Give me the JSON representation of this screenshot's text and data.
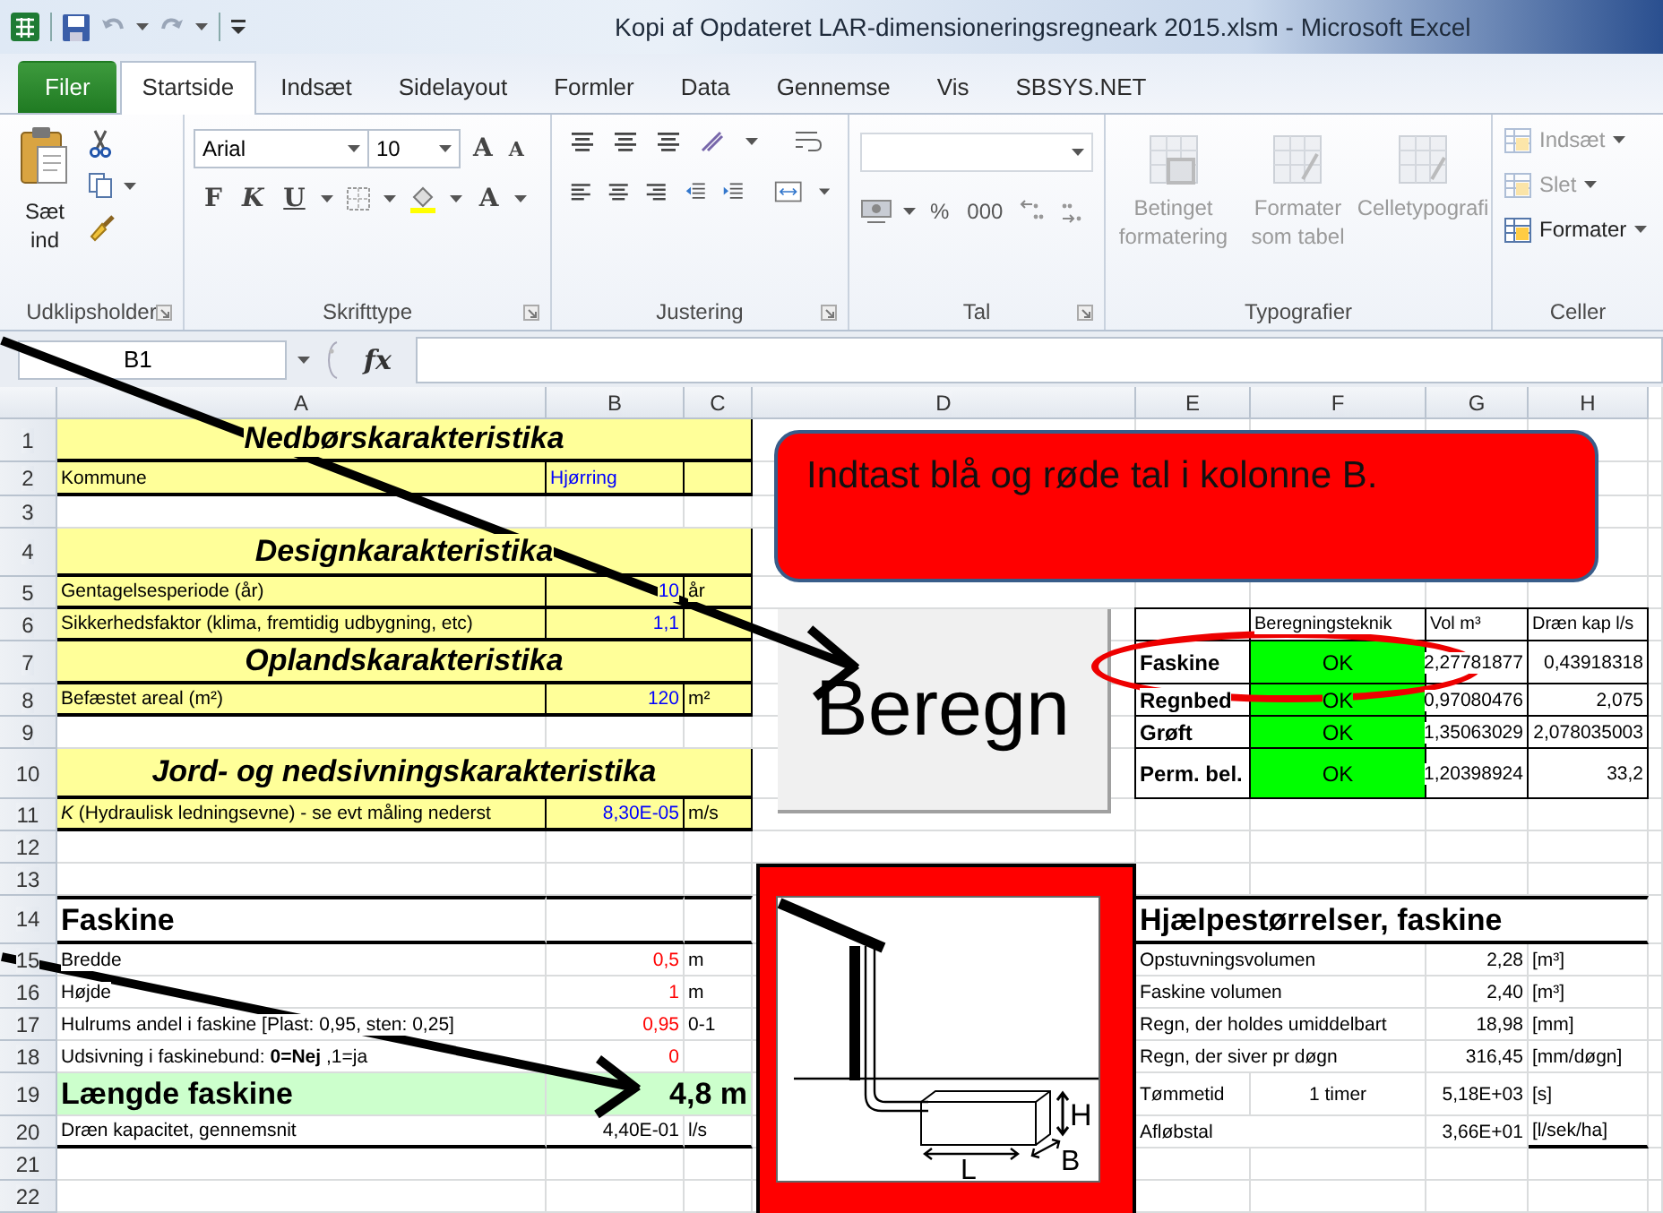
{
  "window": {
    "title": "Kopi af Opdateret LAR-dimensioneringsregneark 2015.xlsm  -  Microsoft Excel"
  },
  "tabs": [
    {
      "label": "Filer",
      "kind": "file",
      "selected": false
    },
    {
      "label": "Startside",
      "kind": "tab",
      "selected": true
    },
    {
      "label": "Indsæt",
      "kind": "tab",
      "selected": false
    },
    {
      "label": "Sidelayout",
      "kind": "tab",
      "selected": false
    },
    {
      "label": "Formler",
      "kind": "tab",
      "selected": false
    },
    {
      "label": "Data",
      "kind": "tab",
      "selected": false
    },
    {
      "label": "Gennemse",
      "kind": "tab",
      "selected": false
    },
    {
      "label": "Vis",
      "kind": "tab",
      "selected": false
    },
    {
      "label": "SBSYS.NET",
      "kind": "tab",
      "selected": false
    }
  ],
  "ribbon": {
    "clipboard": {
      "group": "Udklipsholder",
      "paste": "Sæt ind"
    },
    "font": {
      "group": "Skrifttype",
      "family": "Arial",
      "size": "10",
      "grow": "A",
      "shrink": "A",
      "bold": "F",
      "italic": "K",
      "underline": "U",
      "color_button": "A"
    },
    "alignment": {
      "group": "Justering"
    },
    "number": {
      "group": "Tal",
      "percent": "%",
      "thousands": "000"
    },
    "styles": {
      "group": "Typografier",
      "items": [
        {
          "label": "Betinget formatering",
          "disabled": true
        },
        {
          "label": "Formater som tabel",
          "disabled": true
        },
        {
          "label": "Celletypografi",
          "disabled": true
        }
      ]
    },
    "cells": {
      "group": "Celler",
      "items": [
        {
          "label": "Indsæt",
          "disabled": true
        },
        {
          "label": "Slet",
          "disabled": true
        },
        {
          "label": "Formater",
          "disabled": false
        }
      ]
    }
  },
  "formula_bar": {
    "name_box": "B1",
    "function_label": "fx"
  },
  "sheet": {
    "columns": [
      "A",
      "B",
      "C",
      "D",
      "E",
      "F",
      "G",
      "H"
    ],
    "rows": [
      {
        "number": "1",
        "kind": "section",
        "label": "Nedbørskarakteristika"
      },
      {
        "number": "2",
        "kind": "field_text",
        "label": "Kommune",
        "value": "Hjørring"
      },
      {
        "number": "3",
        "kind": "blank"
      },
      {
        "number": "4",
        "kind": "section",
        "label": "Designkarakteristika"
      },
      {
        "number": "5",
        "kind": "field",
        "label": "Gentagelsesperiode (år)",
        "value": "10",
        "unit": "år"
      },
      {
        "number": "6",
        "kind": "field",
        "label": "Sikkerhedsfaktor (klima, fremtidig udbygning, etc)",
        "value": "1,1"
      },
      {
        "number": "7",
        "kind": "section",
        "label": "Oplandskarakteristika"
      },
      {
        "number": "8",
        "kind": "field",
        "label": "Befæstet areal (m²)",
        "value": "120",
        "unit": "m²"
      },
      {
        "number": "9",
        "kind": "blank"
      },
      {
        "number": "10",
        "kind": "section",
        "label": "Jord- og nedsivningskarakteristika"
      },
      {
        "number": "11",
        "kind": "field",
        "label": "*K* (Hydraulisk ledningsevne) - se evt måling nederst",
        "value": "8,30E-05",
        "unit": "m/s"
      },
      {
        "number": "12",
        "kind": "blank"
      },
      {
        "number": "13",
        "kind": "blank"
      },
      {
        "number": "14",
        "kind": "heading",
        "label": "Faskine"
      },
      {
        "number": "15",
        "kind": "input",
        "label": "Bredde",
        "value": "0,5",
        "unit": "m"
      },
      {
        "number": "16",
        "kind": "input",
        "label": "Højde",
        "value": "1",
        "unit": "m"
      },
      {
        "number": "17",
        "kind": "input",
        "label": "Hulrums andel i faskine [Plast: 0,95, sten: 0,25]",
        "value": "0,95",
        "unit": "0-1"
      },
      {
        "number": "18",
        "kind": "input",
        "label": "Udsivning i faskinebund: **0=Nej** ,1=ja",
        "value": "0"
      },
      {
        "number": "19",
        "kind": "result",
        "label": "Længde faskine",
        "value": "4,8 m"
      },
      {
        "number": "20",
        "kind": "plain",
        "label": "Dræn kapacitet, gennemsnit",
        "value": "4,40E-01",
        "unit": "l/s"
      },
      {
        "number": "21",
        "kind": "blank"
      },
      {
        "number": "22",
        "kind": "blank"
      }
    ],
    "notice": "Indtast blå og røde tal i kolonne B.",
    "calc_button": "Beregn",
    "results": {
      "header": [
        "Beregningsteknik",
        "Vol m³",
        "Dræn kap l/s"
      ],
      "rows": [
        {
          "name": "Faskine",
          "status": "OK",
          "volume": "2,27781877",
          "capacity": "0,43918318"
        },
        {
          "name": "Regnbed",
          "status": "OK",
          "volume": "0,97080476",
          "capacity": "2,075"
        },
        {
          "name": "Grøft",
          "status": "OK",
          "volume": "1,35063029",
          "capacity": "2,078035003"
        },
        {
          "name": "Perm. bel.",
          "status": "OK",
          "volume": "1,20398924",
          "capacity": "33,2"
        }
      ]
    },
    "helper": {
      "title": "Hjælpestørrelser, faskine",
      "rows": [
        {
          "label": "Opstuvningsvolumen",
          "value": "2,28",
          "unit": "[m³]"
        },
        {
          "label": "Faskine volumen",
          "value": "2,40",
          "unit": "[m³]"
        },
        {
          "label": "Regn, der holdes umiddelbart",
          "value": "18,98",
          "unit": "[mm]"
        },
        {
          "label": "Regn, der siver pr døgn",
          "value": "316,45",
          "unit": "[mm/døgn]"
        },
        {
          "label": "Tømmetid",
          "note": "1 timer",
          "value": "5,18E+03",
          "unit": "[s]"
        },
        {
          "label": "Afløbstal",
          "value": "3,66E+01",
          "unit": "[l/sek/ha]"
        }
      ]
    },
    "drawing": {
      "height_label": "H",
      "length_label": "L",
      "width_label": "B"
    }
  }
}
